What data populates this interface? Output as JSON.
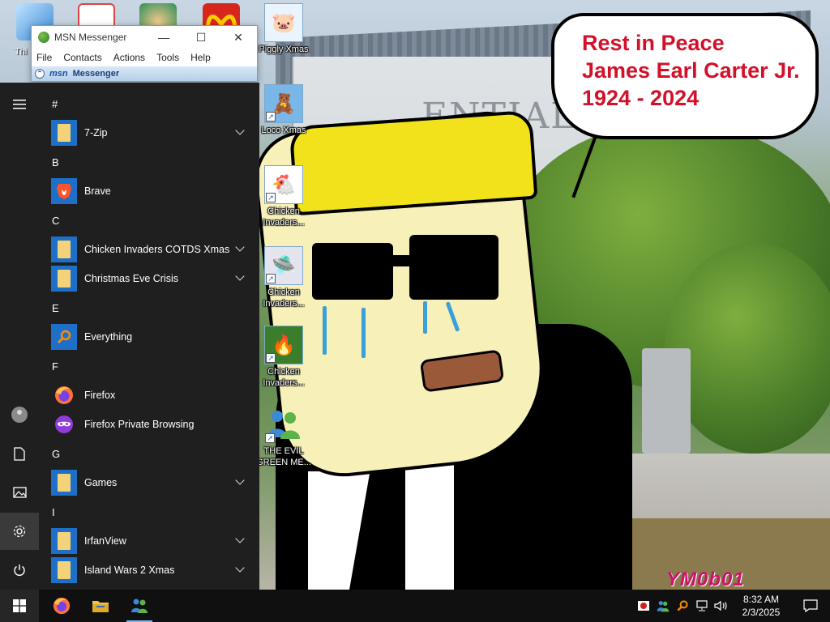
{
  "speech_bubble": {
    "line1": "Rest in Peace",
    "line2": "James Earl Carter Jr.",
    "line3": "1924 - 2024"
  },
  "watermark": "YM0b01",
  "wallpaper": {
    "sign_text": "ENTIAL"
  },
  "desktop_icons": [
    {
      "label": "Thi",
      "icon": "this-pc-icon"
    },
    {
      "label": "Piggly Xmas",
      "icon": "pig-icon"
    },
    {
      "label": "Loco Xmas",
      "icon": "bear-icon"
    },
    {
      "label": "Chicken Invaders...",
      "icon": "chicken-icon"
    },
    {
      "label": "Chicken Invaders...",
      "icon": "spaceship-icon"
    },
    {
      "label": "Chicken Invaders...",
      "icon": "chicken-fire-icon"
    },
    {
      "label": "THE EVIL GREEN ME...",
      "icon": "messenger-people-icon"
    }
  ],
  "msn": {
    "title": "MSN Messenger",
    "menu": [
      "File",
      "Contacts",
      "Actions",
      "Tools",
      "Help"
    ],
    "banner_logo": "msn",
    "banner_text": "Messenger"
  },
  "start_menu": {
    "groups": [
      {
        "letter": "#",
        "apps": [
          {
            "name": "7-Zip",
            "icon": "folder-icon",
            "expandable": true
          }
        ]
      },
      {
        "letter": "B",
        "apps": [
          {
            "name": "Brave",
            "icon": "brave-icon",
            "expandable": false
          }
        ]
      },
      {
        "letter": "C",
        "apps": [
          {
            "name": "Chicken Invaders COTDS Xmas",
            "icon": "folder-icon",
            "expandable": true
          },
          {
            "name": "Christmas Eve Crisis",
            "icon": "folder-icon",
            "expandable": true
          }
        ]
      },
      {
        "letter": "E",
        "apps": [
          {
            "name": "Everything",
            "icon": "search-icon",
            "expandable": false
          }
        ]
      },
      {
        "letter": "F",
        "apps": [
          {
            "name": "Firefox",
            "icon": "firefox-icon",
            "expandable": false
          },
          {
            "name": "Firefox Private Browsing",
            "icon": "firefox-private-icon",
            "expandable": false
          }
        ]
      },
      {
        "letter": "G",
        "apps": [
          {
            "name": "Games",
            "icon": "folder-icon",
            "expandable": true
          }
        ]
      },
      {
        "letter": "I",
        "apps": [
          {
            "name": "IrfanView",
            "icon": "folder-icon",
            "expandable": true
          },
          {
            "name": "Island Wars 2 Xmas",
            "icon": "folder-icon",
            "expandable": true
          }
        ]
      }
    ],
    "rail": [
      "hamburger-icon",
      "user-icon",
      "documents-icon",
      "pictures-icon",
      "settings-icon",
      "power-icon"
    ]
  },
  "taskbar": {
    "pinned": [
      "start-icon",
      "firefox-icon",
      "file-explorer-icon",
      "msn-messenger-icon"
    ],
    "tray": [
      "antivirus-icon",
      "messenger-tray-icon",
      "everything-tray-icon",
      "network-icon",
      "volume-icon"
    ],
    "time": "8:32 AM",
    "date": "2/3/2025"
  },
  "colors": {
    "start_bg": "#1f1f1f",
    "taskbar_bg": "#101010",
    "tile_blue": "#1e6fc7",
    "bubble_text": "#d3102a"
  }
}
